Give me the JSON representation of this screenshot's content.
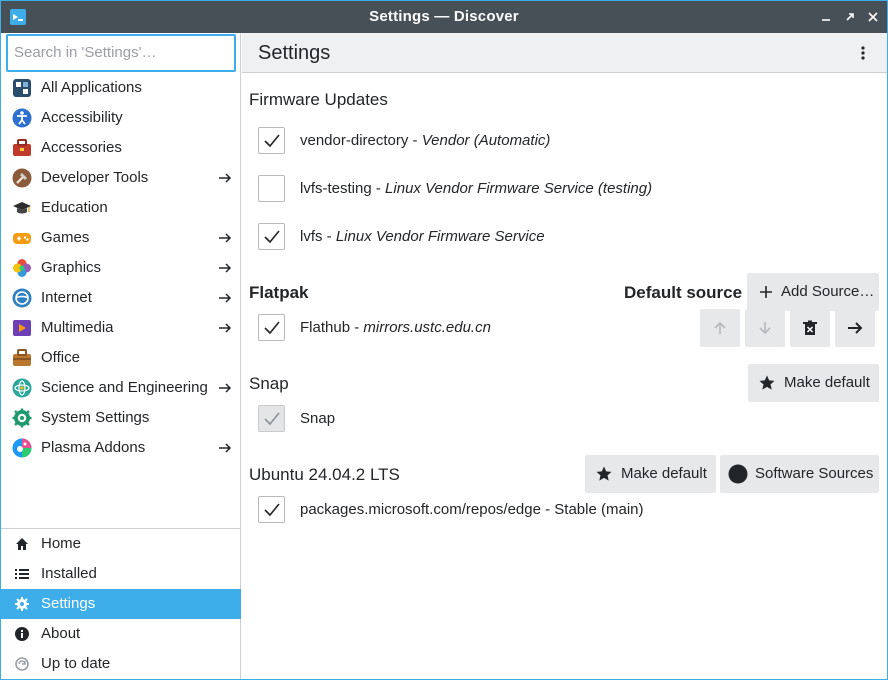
{
  "window": {
    "title": "Settings — Discover",
    "accent": "#3daee9",
    "titlebar_color": "#475057"
  },
  "search": {
    "placeholder": "Search in 'Settings'…"
  },
  "categories": [
    {
      "label": "All Applications",
      "icon": "all-applications-icon",
      "has_arrow": false
    },
    {
      "label": "Accessibility",
      "icon": "accessibility-icon",
      "has_arrow": false
    },
    {
      "label": "Accessories",
      "icon": "accessories-icon",
      "has_arrow": false
    },
    {
      "label": "Developer Tools",
      "icon": "developer-tools-icon",
      "has_arrow": true
    },
    {
      "label": "Education",
      "icon": "education-icon",
      "has_arrow": false
    },
    {
      "label": "Games",
      "icon": "games-icon",
      "has_arrow": true
    },
    {
      "label": "Graphics",
      "icon": "graphics-icon",
      "has_arrow": true
    },
    {
      "label": "Internet",
      "icon": "internet-icon",
      "has_arrow": true
    },
    {
      "label": "Multimedia",
      "icon": "multimedia-icon",
      "has_arrow": true
    },
    {
      "label": "Office",
      "icon": "office-icon",
      "has_arrow": false
    },
    {
      "label": "Science and Engineering",
      "icon": "science-icon",
      "has_arrow": true
    },
    {
      "label": "System Settings",
      "icon": "system-settings-icon",
      "has_arrow": false
    },
    {
      "label": "Plasma Addons",
      "icon": "plasma-addons-icon",
      "has_arrow": true
    }
  ],
  "nav": [
    {
      "label": "Home",
      "icon": "home-icon",
      "active": false
    },
    {
      "label": "Installed",
      "icon": "list-icon",
      "active": false
    },
    {
      "label": "Settings",
      "icon": "gear-icon",
      "active": true
    },
    {
      "label": "About",
      "icon": "info-icon",
      "active": false
    },
    {
      "label": "Up to date",
      "icon": "refresh-icon",
      "active": false
    }
  ],
  "page": {
    "title": "Settings"
  },
  "firmware": {
    "title": "Firmware Updates",
    "sources": [
      {
        "name": "vendor-directory",
        "desc": "Vendor (Automatic)",
        "checked": true
      },
      {
        "name": "lvfs-testing",
        "desc": "Linux Vendor Firmware Service (testing)",
        "checked": false
      },
      {
        "name": "lvfs",
        "desc": "Linux Vendor Firmware Service",
        "checked": true
      }
    ]
  },
  "flatpak": {
    "title": "Flatpak",
    "default_label": "Default source",
    "add_source_label": "Add Source…",
    "source": {
      "name": "Flathub",
      "desc": "mirrors.ustc.edu.cn",
      "checked": true
    }
  },
  "snap": {
    "title": "Snap",
    "make_default_label": "Make default",
    "source": {
      "name": "Snap",
      "checked": true,
      "disabled": true
    }
  },
  "ubuntu": {
    "title": "Ubuntu 24.04.2 LTS",
    "make_default_label": "Make default",
    "software_sources_label": "Software Sources",
    "source": {
      "name": "packages.microsoft.com/repos/edge - Stable (main)",
      "checked": true
    }
  },
  "separator": " - "
}
